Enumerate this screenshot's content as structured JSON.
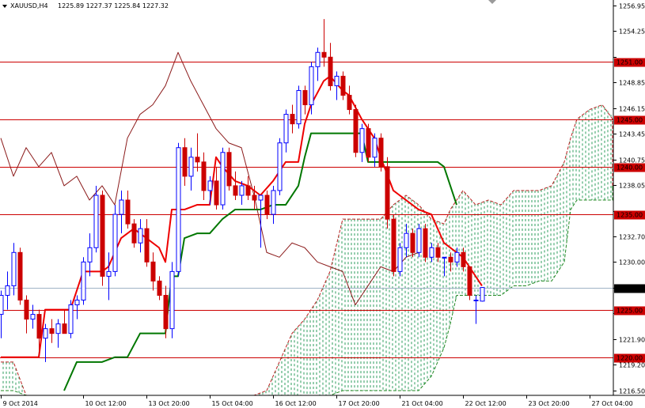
{
  "chart_data": {
    "type": "candlestick",
    "symbol_label": "XAUUSD,H4",
    "ohlc_text": "1225.89 1227.37 1225.84 1227.32",
    "current_price": 1227.32,
    "ylim": [
      1216.0,
      1257.5
    ],
    "y_ticks": [
      "1256.95",
      "1254.25",
      "1251.50",
      "1248.85",
      "1246.15",
      "1243.45",
      "1240.75",
      "1238.05",
      "1235.30",
      "1232.70",
      "1230.00",
      "1227.30",
      "1224.60",
      "1221.90",
      "1219.20",
      "1216.50"
    ],
    "x_ticks": [
      {
        "label": "9 Oct 2014",
        "index": 0
      },
      {
        "label": "10 Oct 12:00",
        "index": 13
      },
      {
        "label": "13 Oct 20:00",
        "index": 23
      },
      {
        "label": "15 Oct 04:00",
        "index": 33
      },
      {
        "label": "16 Oct 12:00",
        "index": 43
      },
      {
        "label": "17 Oct 20:00",
        "index": 53
      },
      {
        "label": "21 Oct 04:00",
        "index": 63
      },
      {
        "label": "22 Oct 12:00",
        "index": 73
      },
      {
        "label": "23 Oct 20:00",
        "index": 83
      },
      {
        "label": "27 Oct 04:00",
        "index": 93
      }
    ],
    "levels": [
      {
        "value": 1251.0,
        "label": "1251.00"
      },
      {
        "value": 1245.0,
        "label": "1245.00"
      },
      {
        "value": 1240.0,
        "label": "1240.00"
      },
      {
        "value": 1235.0,
        "label": "1235.00"
      },
      {
        "value": 1225.0,
        "label": "1225.00"
      },
      {
        "value": 1220.0,
        "label": "1220.00"
      }
    ],
    "candles": [
      [
        1224.5,
        1227.0,
        1222.0,
        1226.5
      ],
      [
        1226.5,
        1229.0,
        1225.0,
        1227.5
      ],
      [
        1227.5,
        1232.0,
        1226.5,
        1231.0
      ],
      [
        1231.0,
        1231.5,
        1225.5,
        1226.0
      ],
      [
        1226.0,
        1226.5,
        1222.5,
        1224.0
      ],
      [
        1224.0,
        1225.5,
        1223.0,
        1224.5
      ],
      [
        1224.5,
        1225.0,
        1220.0,
        1222.0
      ],
      [
        1222.0,
        1223.5,
        1219.5,
        1223.0
      ],
      [
        1223.0,
        1224.0,
        1221.5,
        1222.5
      ],
      [
        1222.5,
        1224.0,
        1221.0,
        1223.5
      ],
      [
        1223.5,
        1225.0,
        1222.5,
        1222.5
      ],
      [
        1222.5,
        1226.0,
        1222.0,
        1225.5
      ],
      [
        1225.5,
        1226.5,
        1224.0,
        1226.0
      ],
      [
        1226.0,
        1230.5,
        1225.5,
        1230.0
      ],
      [
        1230.0,
        1233.0,
        1228.5,
        1231.5
      ],
      [
        1231.5,
        1238.0,
        1231.0,
        1237.0
      ],
      [
        1237.0,
        1237.5,
        1227.5,
        1228.5
      ],
      [
        1228.5,
        1231.0,
        1226.0,
        1229.0
      ],
      [
        1229.0,
        1236.0,
        1228.5,
        1235.0
      ],
      [
        1235.0,
        1237.5,
        1233.0,
        1236.5
      ],
      [
        1236.5,
        1237.5,
        1233.5,
        1234.0
      ],
      [
        1234.0,
        1234.5,
        1231.5,
        1232.0
      ],
      [
        1232.0,
        1234.5,
        1231.0,
        1233.5
      ],
      [
        1233.5,
        1234.5,
        1229.5,
        1230.0
      ],
      [
        1230.0,
        1231.0,
        1227.0,
        1228.0
      ],
      [
        1228.0,
        1228.5,
        1226.0,
        1226.5
      ],
      [
        1226.5,
        1227.5,
        1222.0,
        1223.0
      ],
      [
        1223.0,
        1230.0,
        1222.0,
        1229.0
      ],
      [
        1229.0,
        1242.5,
        1228.5,
        1242.0
      ],
      [
        1242.0,
        1243.0,
        1238.0,
        1239.0
      ],
      [
        1239.0,
        1242.0,
        1237.5,
        1241.0
      ],
      [
        1241.0,
        1243.5,
        1239.5,
        1240.5
      ],
      [
        1240.5,
        1241.5,
        1236.5,
        1237.5
      ],
      [
        1237.5,
        1239.0,
        1236.0,
        1238.5
      ],
      [
        1238.5,
        1240.0,
        1235.5,
        1236.0
      ],
      [
        1236.0,
        1242.0,
        1235.5,
        1241.5
      ],
      [
        1241.5,
        1242.0,
        1237.5,
        1238.0
      ],
      [
        1238.0,
        1239.5,
        1236.5,
        1237.0
      ],
      [
        1237.0,
        1238.5,
        1236.0,
        1238.0
      ],
      [
        1238.0,
        1239.0,
        1236.5,
        1237.0
      ],
      [
        1237.0,
        1238.0,
        1235.5,
        1236.5
      ],
      [
        1236.5,
        1237.0,
        1231.5,
        1237.0
      ],
      [
        1237.0,
        1237.5,
        1234.5,
        1235.0
      ],
      [
        1235.0,
        1238.0,
        1234.0,
        1237.5
      ],
      [
        1237.5,
        1243.0,
        1237.0,
        1242.5
      ],
      [
        1242.5,
        1246.0,
        1241.5,
        1245.5
      ],
      [
        1245.5,
        1246.5,
        1243.5,
        1244.5
      ],
      [
        1244.5,
        1248.5,
        1244.0,
        1248.0
      ],
      [
        1248.0,
        1248.5,
        1245.5,
        1246.5
      ],
      [
        1246.5,
        1251.0,
        1245.5,
        1250.5
      ],
      [
        1250.5,
        1252.5,
        1249.0,
        1252.0
      ],
      [
        1252.0,
        1255.5,
        1250.5,
        1251.5
      ],
      [
        1251.5,
        1253.0,
        1248.0,
        1248.5
      ],
      [
        1248.5,
        1250.0,
        1247.0,
        1249.5
      ],
      [
        1249.5,
        1250.0,
        1247.0,
        1247.5
      ],
      [
        1247.5,
        1248.5,
        1245.5,
        1246.0
      ],
      [
        1246.0,
        1246.5,
        1241.0,
        1241.5
      ],
      [
        1241.5,
        1244.5,
        1240.5,
        1244.0
      ],
      [
        1244.0,
        1244.5,
        1240.5,
        1241.0
      ],
      [
        1241.0,
        1243.5,
        1240.0,
        1243.0
      ],
      [
        1243.0,
        1243.5,
        1239.5,
        1240.0
      ],
      [
        1240.0,
        1241.0,
        1233.5,
        1234.5
      ],
      [
        1234.5,
        1235.0,
        1228.5,
        1229.0
      ],
      [
        1229.0,
        1232.0,
        1228.5,
        1231.5
      ],
      [
        1231.5,
        1234.0,
        1230.5,
        1233.0
      ],
      [
        1233.0,
        1233.5,
        1230.5,
        1231.0
      ],
      [
        1231.0,
        1234.0,
        1230.5,
        1233.5
      ],
      [
        1233.5,
        1234.0,
        1230.0,
        1230.5
      ],
      [
        1230.5,
        1232.0,
        1230.0,
        1231.5
      ],
      [
        1231.5,
        1232.0,
        1230.0,
        1230.5
      ],
      [
        1230.5,
        1230.5,
        1228.5,
        1230.5
      ],
      [
        1230.5,
        1231.0,
        1229.0,
        1230.0
      ],
      [
        1230.0,
        1231.5,
        1229.5,
        1231.0
      ],
      [
        1231.0,
        1231.5,
        1229.0,
        1229.5
      ],
      [
        1229.5,
        1229.5,
        1226.0,
        1226.5
      ],
      [
        1226.0,
        1226.5,
        1223.5,
        1226.0
      ],
      [
        1225.89,
        1227.37,
        1225.84,
        1227.32
      ]
    ],
    "tenkan_sen": [
      [
        0,
        1220.0
      ],
      [
        3,
        1220.0
      ],
      [
        6,
        1220.0
      ],
      [
        7,
        1225.0
      ],
      [
        10,
        1225.0
      ],
      [
        11,
        1225.0
      ],
      [
        13,
        1229.0
      ],
      [
        16,
        1229.0
      ],
      [
        17,
        1229.5
      ],
      [
        19,
        1232.5
      ],
      [
        21,
        1233.5
      ],
      [
        23,
        1232.5
      ],
      [
        25,
        1231.5
      ],
      [
        26,
        1230.0
      ],
      [
        27,
        1235.5
      ],
      [
        29,
        1235.5
      ],
      [
        31,
        1236.0
      ],
      [
        33,
        1236.0
      ],
      [
        34,
        1241.0
      ],
      [
        35,
        1240.0
      ],
      [
        37,
        1238.5
      ],
      [
        39,
        1238.0
      ],
      [
        41,
        1237.0
      ],
      [
        43,
        1238.5
      ],
      [
        45,
        1240.5
      ],
      [
        47,
        1240.5
      ],
      [
        48,
        1244.5
      ],
      [
        49,
        1246.5
      ],
      [
        51,
        1249.0
      ],
      [
        52,
        1249.5
      ],
      [
        54,
        1248.0
      ],
      [
        55,
        1247.5
      ],
      [
        57,
        1245.0
      ],
      [
        59,
        1243.0
      ],
      [
        60,
        1241.0
      ],
      [
        62,
        1237.5
      ],
      [
        63,
        1237.0
      ],
      [
        66,
        1235.5
      ],
      [
        68,
        1235.0
      ],
      [
        70,
        1232.0
      ],
      [
        72,
        1231.0
      ],
      [
        73,
        1230.5
      ],
      [
        75,
        1228.5
      ],
      [
        76,
        1227.5
      ]
    ],
    "kijun_sen": [
      [
        10,
        1216.5
      ],
      [
        12,
        1219.5
      ],
      [
        14,
        1219.5
      ],
      [
        16,
        1219.5
      ],
      [
        18,
        1220.0
      ],
      [
        20,
        1220.0
      ],
      [
        22,
        1222.5
      ],
      [
        24,
        1222.5
      ],
      [
        26,
        1222.5
      ],
      [
        27,
        1228.5
      ],
      [
        28,
        1228.5
      ],
      [
        29,
        1232.5
      ],
      [
        31,
        1233.0
      ],
      [
        33,
        1233.0
      ],
      [
        35,
        1234.5
      ],
      [
        37,
        1235.5
      ],
      [
        39,
        1235.5
      ],
      [
        41,
        1235.5
      ],
      [
        43,
        1236.0
      ],
      [
        45,
        1236.0
      ],
      [
        47,
        1238.0
      ],
      [
        48,
        1241.0
      ],
      [
        49,
        1243.5
      ],
      [
        52,
        1243.5
      ],
      [
        55,
        1243.5
      ],
      [
        57,
        1243.5
      ],
      [
        58,
        1240.5
      ],
      [
        61,
        1240.5
      ],
      [
        64,
        1240.5
      ],
      [
        67,
        1240.5
      ],
      [
        69,
        1240.5
      ],
      [
        70,
        1240.0
      ],
      [
        71,
        1238.0
      ],
      [
        72,
        1236.0
      ]
    ],
    "chikou_span": [
      [
        0,
        1243.0
      ],
      [
        2,
        1239.0
      ],
      [
        4,
        1242.0
      ],
      [
        6,
        1240.0
      ],
      [
        8,
        1241.5
      ],
      [
        10,
        1238.0
      ],
      [
        12,
        1239.0
      ],
      [
        14,
        1236.5
      ],
      [
        16,
        1238.0
      ],
      [
        18,
        1236.0
      ],
      [
        20,
        1243.0
      ],
      [
        22,
        1245.5
      ],
      [
        24,
        1246.5
      ],
      [
        26,
        1248.5
      ],
      [
        28,
        1252.0
      ],
      [
        30,
        1249.0
      ],
      [
        32,
        1246.5
      ],
      [
        34,
        1244.0
      ],
      [
        36,
        1242.5
      ],
      [
        38,
        1242.0
      ],
      [
        40,
        1237.0
      ],
      [
        42,
        1231.0
      ],
      [
        44,
        1230.5
      ],
      [
        46,
        1232.0
      ],
      [
        48,
        1231.5
      ],
      [
        50,
        1230.0
      ],
      [
        52,
        1229.5
      ],
      [
        54,
        1229.0
      ],
      [
        56,
        1225.5
      ],
      [
        57,
        1226.5
      ],
      [
        58,
        1227.5
      ],
      [
        60,
        1229.5
      ],
      [
        62,
        1229.0
      ],
      [
        64,
        1230.5
      ],
      [
        66,
        1231.0
      ]
    ],
    "cloud": [
      [
        0,
        1219.5,
        1216.5
      ],
      [
        2,
        1219.5,
        1216.5
      ],
      [
        4,
        1216.0,
        1216.0
      ],
      [
        8,
        1216.0,
        1216.0
      ],
      [
        12,
        1216.0,
        1216.0
      ],
      [
        16,
        1216.0,
        1216.0
      ],
      [
        20,
        1216.0,
        1216.0
      ],
      [
        24,
        1216.0,
        1216.0
      ],
      [
        28,
        1216.0,
        1216.0
      ],
      [
        32,
        1216.0,
        1216.0
      ],
      [
        36,
        1216.0,
        1216.0
      ],
      [
        40,
        1216.0,
        1216.0
      ],
      [
        42,
        1216.5,
        1216.0
      ],
      [
        44,
        1219.5,
        1216.0
      ],
      [
        46,
        1222.5,
        1216.0
      ],
      [
        48,
        1224.0,
        1216.0
      ],
      [
        50,
        1226.0,
        1216.0
      ],
      [
        52,
        1229.0,
        1216.0
      ],
      [
        54,
        1234.5,
        1216.5
      ],
      [
        56,
        1234.5,
        1216.5
      ],
      [
        58,
        1234.5,
        1216.5
      ],
      [
        60,
        1234.5,
        1216.5
      ],
      [
        62,
        1236.0,
        1216.5
      ],
      [
        64,
        1237.0,
        1216.5
      ],
      [
        66,
        1236.0,
        1216.5
      ],
      [
        68,
        1234.5,
        1218.0
      ],
      [
        70,
        1234.0,
        1221.0
      ],
      [
        71,
        1235.5,
        1223.5
      ],
      [
        72,
        1236.5,
        1226.5
      ],
      [
        73,
        1237.5,
        1226.5
      ],
      [
        75,
        1236.0,
        1226.5
      ],
      [
        77,
        1236.5,
        1226.5
      ],
      [
        79,
        1236.0,
        1226.5
      ],
      [
        81,
        1237.5,
        1227.5
      ],
      [
        83,
        1237.5,
        1227.5
      ],
      [
        85,
        1237.5,
        1228.0
      ],
      [
        87,
        1238.0,
        1228.0
      ],
      [
        89,
        1240.5,
        1230.0
      ],
      [
        90,
        1243.0,
        1235.5
      ],
      [
        91,
        1245.0,
        1236.5
      ],
      [
        93,
        1246.0,
        1236.5
      ],
      [
        95,
        1246.5,
        1236.5
      ],
      [
        97,
        1245.0,
        1236.5
      ],
      [
        99,
        1241.5,
        1237.5
      ],
      [
        101,
        1239.5,
        1238.0
      ],
      [
        103,
        1239.0,
        1238.0
      ],
      [
        105,
        1238.0,
        1238.0
      ],
      [
        107,
        1238.0,
        1237.5
      ]
    ],
    "colors": {
      "up": "#0000ff",
      "down": "#cc0000",
      "tenkan": "#ee0000",
      "kijun": "#007700",
      "chikou": "#8b1a1a",
      "cloud_hatch": "#2e9e5e",
      "cloud_edge_upper": "#bb2222",
      "cloud_edge_lower": "#228822",
      "level_line": "#cc0000",
      "level_label_bg": "#cc0000",
      "current_label_bg": "#000000"
    }
  }
}
